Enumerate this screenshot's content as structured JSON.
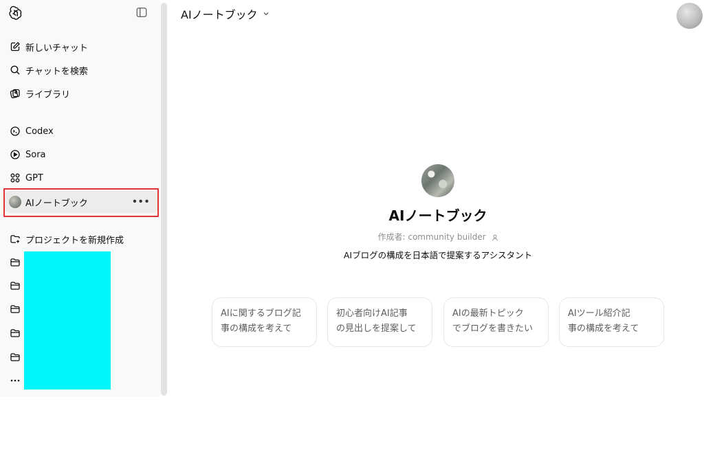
{
  "sidebar": {
    "logo_icon": "openai-logo-icon",
    "toggle_icon": "sidebar-toggle-icon",
    "items": [
      {
        "label": "新しいチャット",
        "icon": "edit-icon"
      },
      {
        "label": "チャットを検索",
        "icon": "search-icon"
      },
      {
        "label": "ライブラリ",
        "icon": "library-icon"
      },
      {
        "label": "Codex",
        "icon": "codex-icon"
      },
      {
        "label": "Sora",
        "icon": "play-icon"
      },
      {
        "label": "GPT",
        "icon": "grid-icon"
      },
      {
        "label": "AIノートブック",
        "icon": "gpt-avatar"
      }
    ],
    "new_project_label": "プロジェクトを新規作成",
    "more_dots": "•••",
    "highlight_color": "#e03434",
    "redaction_color": "#00f6fb"
  },
  "header": {
    "title": "AIノートブック"
  },
  "gpt": {
    "name": "AIノートブック",
    "creator": "作成者: community builder",
    "description": "AIブログの構成を日本語で提案するアシスタント"
  },
  "starters": [
    {
      "line1": "AIに関するブログ記",
      "line2": "事の構成を考えて"
    },
    {
      "line1": "初心者向けAI記事",
      "line2": "の見出しを提案して"
    },
    {
      "line1": "AIの最新トピック",
      "line2": "でブログを書きたい"
    },
    {
      "line1": "AIツール紹介記",
      "line2": "事の構成を考えて"
    }
  ]
}
